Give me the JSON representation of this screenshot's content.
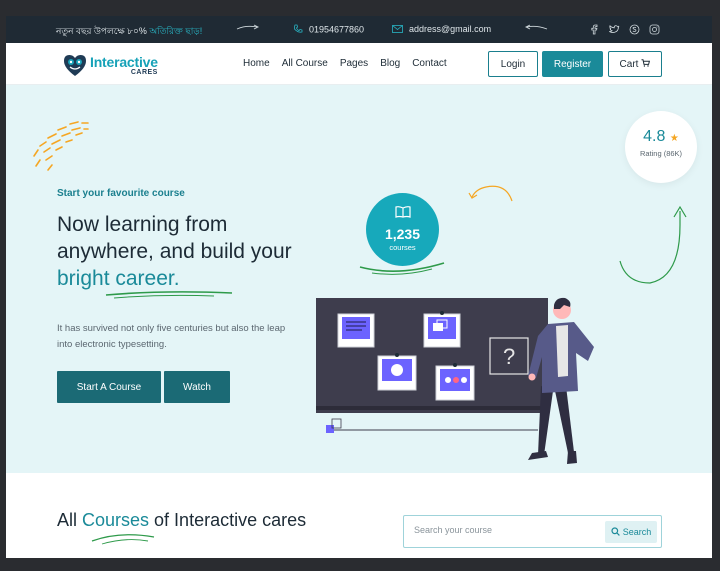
{
  "colors": {
    "brand": "#1a8a99",
    "brand_dark": "#1b6a75",
    "topbar_bg": "#1f2a34",
    "hero_bg": "#e4f5f7",
    "star": "#f5a623",
    "scribble": "#f5a623",
    "swoosh": "#2e9a4a"
  },
  "topbar": {
    "promo_text": "নতুন বছর উপলক্ষে ৮০% ",
    "promo_highlight": "অতিরিক্ত ছাড়!",
    "phone": "01954677860",
    "email": "address@gmail.com",
    "social_icons": [
      "facebook-icon",
      "twitter-icon",
      "skype-icon",
      "instagram-icon"
    ]
  },
  "nav": {
    "logo_line1": "Interactive",
    "logo_line2": "CARES",
    "menu": [
      "Home",
      "All Course",
      "Pages",
      "Blog",
      "Contact"
    ],
    "login": "Login",
    "register": "Register",
    "cart": "Cart"
  },
  "hero": {
    "kicker": "Start your favourite course",
    "headline_part1": "Now learning from anywhere, and build your ",
    "headline_accent": "bright career.",
    "description": "It has survived not only five centuries but also the leap into electronic typesetting.",
    "start_button": "Start A Course",
    "watch_button": "Watch",
    "rating_value": "4.8",
    "rating_sub": "Rating (86K)",
    "courses_count": "1,235",
    "courses_label": "courses"
  },
  "courses_section": {
    "title_part1": "All ",
    "title_accent": "Courses",
    "title_part2": " of Interactive cares",
    "search_placeholder": "Search your course",
    "search_button": "Search"
  }
}
